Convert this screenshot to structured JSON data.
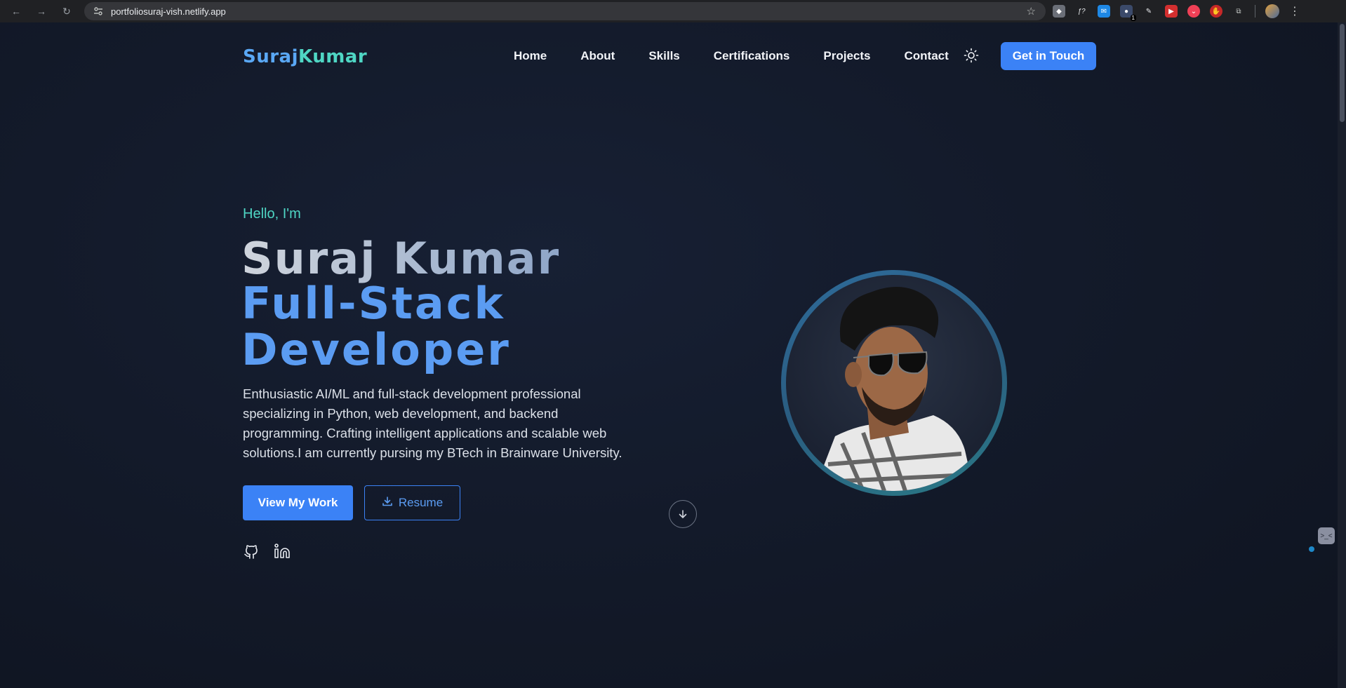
{
  "browser": {
    "url": "portfoliosuraj-vish.netlify.app",
    "extension_badge": "1"
  },
  "header": {
    "logo_first": "Suraj",
    "logo_last": "Kumar",
    "nav": [
      "Home",
      "About",
      "Skills",
      "Certifications",
      "Projects",
      "Contact"
    ],
    "cta_label": "Get in Touch"
  },
  "hero": {
    "greeting": "Hello, I'm",
    "name": "Suraj Kumar",
    "role": "Full-Stack Developer",
    "intro": "Enthusiastic AI/ML and full-stack development professional specializing in Python, web development, and backend programming. Crafting intelligent applications and scalable web solutions.I am currently pursing my BTech in Brainware University.",
    "primary_button": "View My Work",
    "secondary_button": "Resume"
  },
  "colors": {
    "accent_blue": "#3b82f6",
    "accent_teal": "#4fd6c4",
    "background": "#0f1420"
  },
  "icons": {
    "theme": "sun-icon",
    "resume": "download-icon",
    "social": [
      "github-icon",
      "linkedin-icon"
    ],
    "scroll": "arrow-down-icon"
  }
}
